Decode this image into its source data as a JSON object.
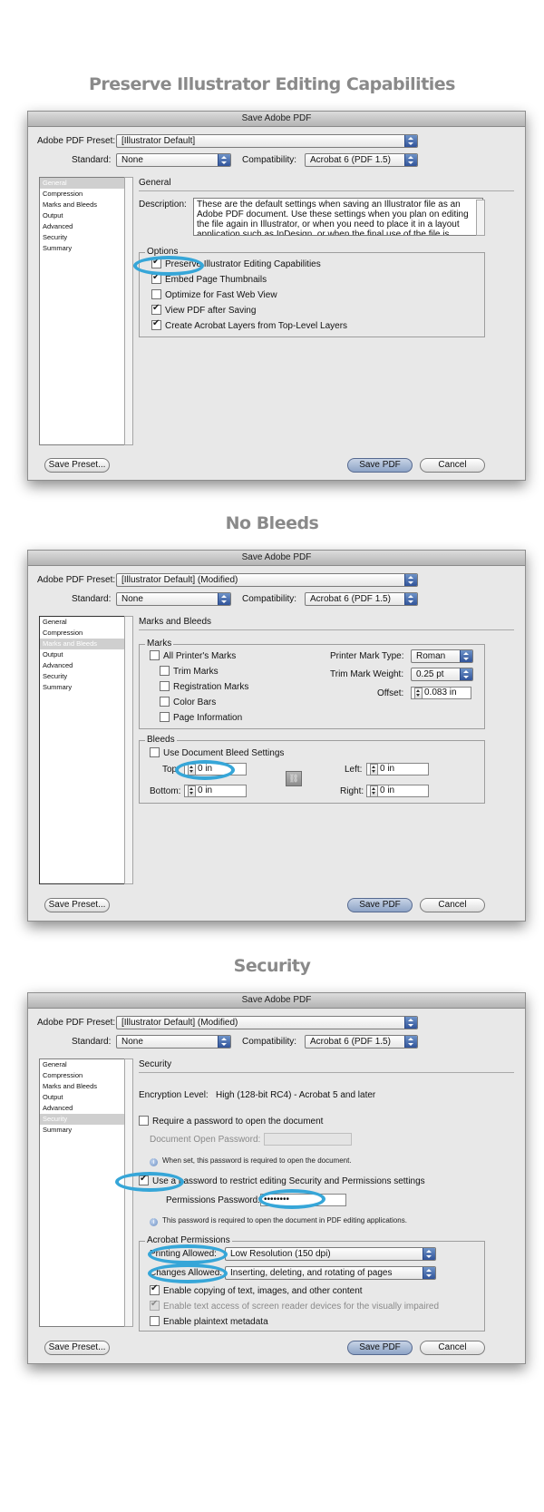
{
  "headings": [
    "Preserve Illustrator Editing Capabilities",
    "No Bleeds",
    "Security"
  ],
  "dialog_title": "Save Adobe PDF",
  "labels": {
    "preset": "Adobe PDF Preset:",
    "standard": "Standard:",
    "compatibility": "Compatibility:"
  },
  "values": {
    "standard": "None",
    "compatibility": "Acrobat 6 (PDF 1.5)"
  },
  "presets": [
    "[Illustrator Default]",
    "[Illustrator Default] (Modified)",
    "[Illustrator Default] (Modified)"
  ],
  "sidebar": [
    "General",
    "Compression",
    "Marks and Bleeds",
    "Output",
    "Advanced",
    "Security",
    "Summary"
  ],
  "buttons": {
    "save_preset": "Save Preset...",
    "save_pdf": "Save PDF",
    "cancel": "Cancel"
  },
  "general": {
    "title": "General",
    "description_label": "Description:",
    "description": "These are the default settings when saving an Illustrator file as an Adobe PDF document. Use these settings when you plan on editing the file again in Illustrator, or when you need to place it in a layout application such as InDesign, or when the final use of the file is",
    "options_title": "Options",
    "options": [
      {
        "label": "Preserve Illustrator Editing Capabilities",
        "checked": true
      },
      {
        "label": "Embed Page Thumbnails",
        "checked": true
      },
      {
        "label": "Optimize for Fast Web View",
        "checked": false
      },
      {
        "label": "View PDF after Saving",
        "checked": true
      },
      {
        "label": "Create Acrobat Layers from Top-Level Layers",
        "checked": true
      }
    ]
  },
  "marks": {
    "title": "Marks and Bleeds",
    "marks_title": "Marks",
    "all_marks": "All Printer's Marks",
    "items": [
      "Trim Marks",
      "Registration Marks",
      "Color Bars",
      "Page Information"
    ],
    "printer_mark_type_label": "Printer Mark Type:",
    "printer_mark_type": "Roman",
    "trim_weight_label": "Trim Mark Weight:",
    "trim_weight": "0.25 pt",
    "offset_label": "Offset:",
    "offset": "0.083 in",
    "bleeds_title": "Bleeds",
    "use_doc_bleed": "Use Document Bleed Settings",
    "top_label": "Top:",
    "bottom_label": "Bottom:",
    "left_label": "Left:",
    "right_label": "Right:",
    "top": "0 in",
    "bottom": "0 in",
    "left": "0 in",
    "right": "0 in"
  },
  "security": {
    "title": "Security",
    "encryption": "Encryption Level:   High (128-bit RC4) - Acrobat 5 and later",
    "require_open_pw": "Require a password to open the document",
    "doc_open_pw_label": "Document Open Password:",
    "note1": "When set, this password is required to open the document.",
    "use_restrict_pw": "Use a password to restrict editing Security and Permissions settings",
    "perm_pw_label": "Permissions Password:",
    "perm_pw": "••••••••",
    "note2": "This password is required to open the document in PDF editing applications.",
    "acrobat_permissions": "Acrobat Permissions",
    "printing_label": "Printing Allowed:",
    "printing": "Low Resolution (150 dpi)",
    "changes_label": "Changes Allowed:",
    "changes": "Inserting, deleting, and rotating of pages",
    "perms": [
      {
        "label": "Enable copying of text, images, and other content",
        "checked": true,
        "disabled": false
      },
      {
        "label": "Enable text access of screen reader devices for the visually impaired",
        "checked": true,
        "disabled": true
      },
      {
        "label": "Enable plaintext metadata",
        "checked": false,
        "disabled": false
      }
    ]
  },
  "colors": {
    "highlight_ring": "#36a6d8",
    "heading": "#8a8a8a"
  }
}
